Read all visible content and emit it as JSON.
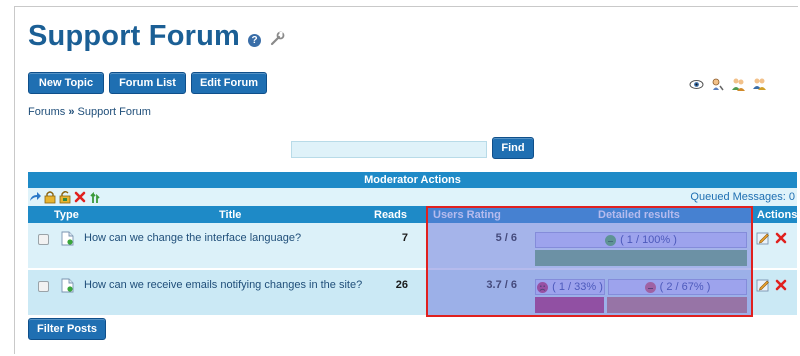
{
  "header": {
    "title": "Support Forum",
    "help_icon_glyph": "?"
  },
  "toolbar": {
    "new_topic": "New Topic",
    "forum_list": "Forum List",
    "edit_forum": "Edit Forum"
  },
  "breadcrumb": {
    "root": "Forums",
    "separator": "»",
    "current": "Support Forum"
  },
  "search": {
    "value": "",
    "placeholder": "",
    "button": "Find"
  },
  "moderator": {
    "header": "Moderator Actions",
    "queued_label": "Queued Messages: 0",
    "icons": [
      "move-icon",
      "lock-icon",
      "unlock-icon",
      "delete-icon",
      "merge-icon"
    ]
  },
  "columns": {
    "type": "Type",
    "title": "Title",
    "reads": "Reads",
    "users_rating": "Users Rating",
    "detailed_results": "Detailed results",
    "actions": "Actions"
  },
  "posts": [
    {
      "title": "How can we change the interface language?",
      "reads": "7",
      "rating": "5 / 6",
      "results": [
        {
          "label": "( 1 / 100% )",
          "face": "neutral",
          "share": 1.0,
          "color": "#6aab6e"
        }
      ]
    },
    {
      "title": "How can we receive emails notifying changes in the site?",
      "reads": "26",
      "rating": "3.7 / 6",
      "results": [
        {
          "label": "( 1 / 33% )",
          "face": "sad",
          "share": 0.33,
          "color": "#b5286b"
        },
        {
          "label": "( 2 / 67% )",
          "face": "neutral-red",
          "share": 0.67,
          "color": "#c07070"
        }
      ]
    }
  ],
  "footer": {
    "filter_posts": "Filter Posts"
  },
  "colors": {
    "primary_button": "#1f6fb2",
    "header_bar": "#1e8ac7",
    "title": "#1b5f95",
    "highlight_border": "#e0201e"
  }
}
